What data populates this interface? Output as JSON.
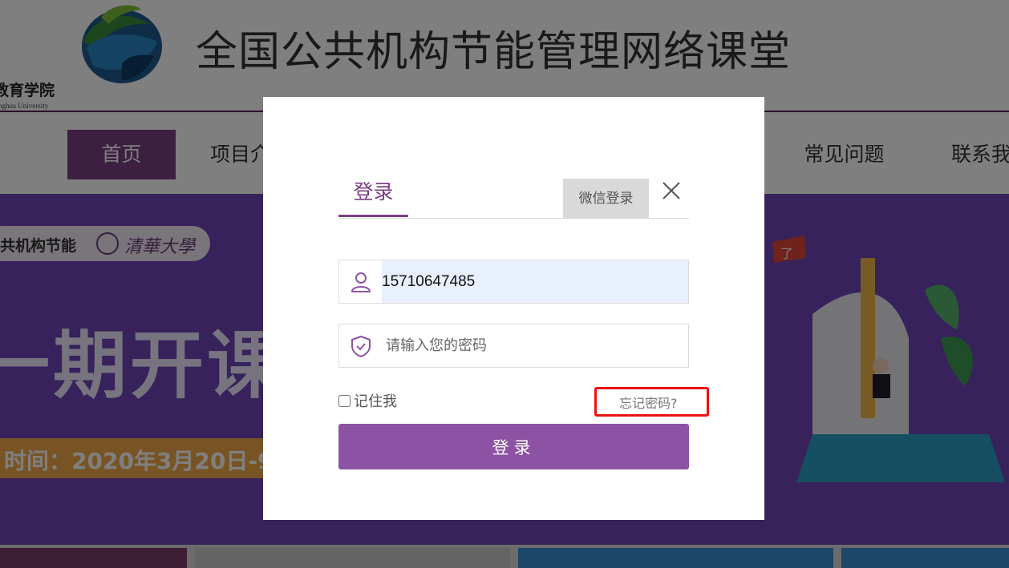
{
  "header": {
    "school_name": "教育学院",
    "school_name_en": "nghua University",
    "site_title": "全国公共机构节能管理网络课堂"
  },
  "nav": {
    "items": [
      {
        "label": "首页",
        "active": true
      },
      {
        "label": "项目介"
      },
      {
        "label": "常见问题"
      },
      {
        "label": "联系我"
      }
    ]
  },
  "banner": {
    "pill_text": "共机构节能",
    "university": "清華大學",
    "big_text": "一期开课",
    "time_text": "时间：2020年3月20日-9",
    "flag_text": "了"
  },
  "login_modal": {
    "tab_login": "登录",
    "wechat_login": "微信登录",
    "username_value": "15710647485",
    "password_placeholder": "请输入您的密码",
    "remember_label": "记住我",
    "forgot_label": "忘记密码?",
    "submit_label": "登录",
    "accent_color": "#8c52a3",
    "highlight_color": "#ee1111"
  },
  "icons": [
    "close-icon",
    "user-icon",
    "shield-check-icon",
    "globe-logo-icon"
  ]
}
